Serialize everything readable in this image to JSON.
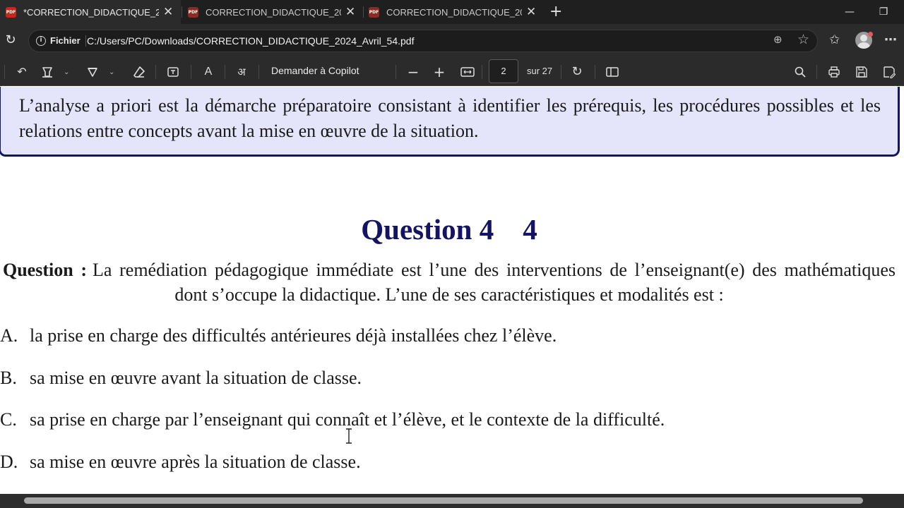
{
  "tabs": [
    {
      "icon": "pdf-file-icon",
      "icon_text": "PDF",
      "title": "*CORRECTION_DIDACTIQUE_2024_Avril_54.pdf",
      "active": true
    },
    {
      "icon": "pdf-file-icon",
      "icon_text": "PDF",
      "title": "CORRECTION_DIDACTIQUE_2024_Avril_54.pdf",
      "active": false
    },
    {
      "icon": "pdf-file-icon",
      "icon_text": "PDF",
      "title": "CORRECTION_DIDACTIQUE_2024_Avril_54.pdf",
      "active": false
    }
  ],
  "address": {
    "scheme_label": "Fichier",
    "url": "C:/Users/PC/Downloads/CORRECTION_DIDACTIQUE_2024_Avril_54.pdf"
  },
  "pdf_toolbar": {
    "copilot_label": "Demander à Copilot",
    "read_aloud_label": "A",
    "translate_label": "अ",
    "current_page": "2",
    "total_pages_label": "sur 27"
  },
  "document": {
    "definition_text": "L’analyse a priori est la démarche préparatoire consistant à identifier les prérequis, les procédures possibles et les relations entre concepts avant la mise en œuvre de la situation.",
    "heading": "Question 4    4",
    "question_label": "Question :",
    "question_text": "La remédiation pédagogique immédiate est l’une des interventions de l’enseignant(e) des mathématiques dont s’occupe la didactique. L’une de ses caractéristiques et modalités est :",
    "options": [
      {
        "letter": "A.",
        "text": "la prise en charge des difficultés antérieures déjà installées chez l’élève."
      },
      {
        "letter": "B.",
        "text": "sa mise en œuvre avant la situation de classe."
      },
      {
        "letter": "C.",
        "text": "sa prise en charge par l’enseignant qui connaît et l’élève, et le contexte de la difficulté."
      },
      {
        "letter": "D.",
        "text": "sa mise en œuvre après la situation de classe."
      }
    ]
  },
  "colors": {
    "browser_chrome": "#2b2b2b",
    "tab_strip": "#1f1f1f",
    "definition_box_fill": "#e4e4fa",
    "definition_box_border": "#151567",
    "heading_color": "#141463"
  }
}
